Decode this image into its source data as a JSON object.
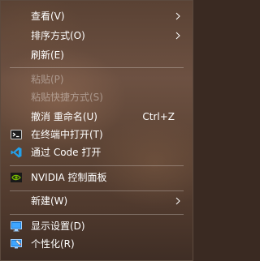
{
  "menu": {
    "items": {
      "view": {
        "label": "查看(V)",
        "has_submenu": true
      },
      "sort": {
        "label": "排序方式(O)",
        "has_submenu": true
      },
      "refresh": {
        "label": "刷新(E)"
      },
      "paste": {
        "label": "粘贴(P)",
        "disabled": true
      },
      "paste_shortcut": {
        "label": "粘贴快捷方式(S)",
        "disabled": true
      },
      "undo_rename": {
        "label": "撤消 重命名(U)",
        "shortcut": "Ctrl+Z"
      },
      "open_terminal": {
        "label": "在终端中打开(T)",
        "icon": "terminal-icon"
      },
      "open_vscode": {
        "label": "通过 Code 打开",
        "icon": "vscode-icon"
      },
      "nvidia": {
        "label": "NVIDIA 控制面板",
        "icon": "nvidia-icon"
      },
      "new": {
        "label": "新建(W)",
        "has_submenu": true
      },
      "display": {
        "label": "显示设置(D)",
        "icon": "display-settings-icon"
      },
      "personalize": {
        "label": "个性化(R)",
        "icon": "personalize-icon"
      }
    }
  },
  "colors": {
    "text": "#ffffff",
    "disabled_text": "#9a8a80",
    "vscode_blue": "#23a0ea",
    "nvidia_green": "#76b900",
    "separator": "#8a7a70"
  }
}
